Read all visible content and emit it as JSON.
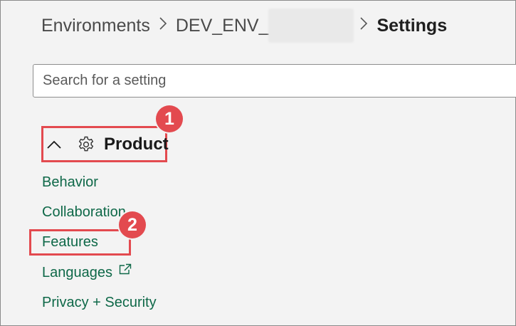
{
  "breadcrumb": {
    "root": "Environments",
    "environment": "DEV_ENV_",
    "current": "Settings",
    "separator": ">"
  },
  "search": {
    "placeholder": "Search for a setting",
    "value": ""
  },
  "section": {
    "title": "Product",
    "expanded": true,
    "icon": "gear-icon",
    "chevron_icon": "chevron-up-icon"
  },
  "nav_items": [
    {
      "label": "Behavior"
    },
    {
      "label": "Collaboration"
    },
    {
      "label": "Features"
    },
    {
      "label": "Languages",
      "icon": "external-link-icon"
    },
    {
      "label": "Privacy + Security"
    }
  ],
  "annotations": {
    "badge_1": "1",
    "badge_2": "2"
  },
  "colors": {
    "accent_link": "#0e6848",
    "highlight": "#e34a4f",
    "background": "#f3f3f3"
  }
}
